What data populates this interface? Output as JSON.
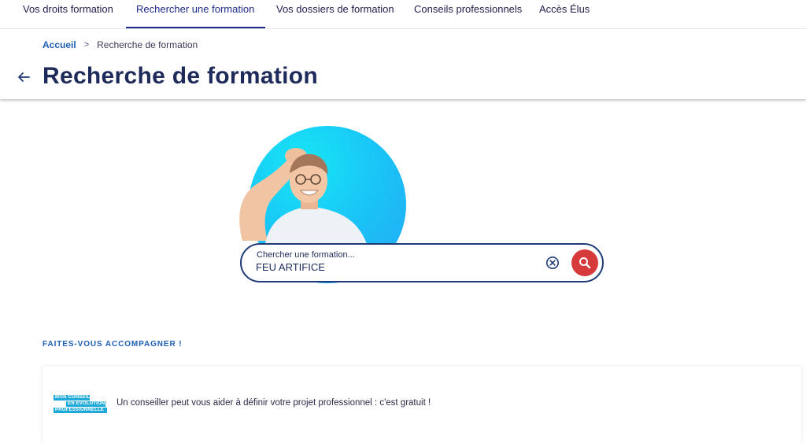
{
  "nav": {
    "items": [
      {
        "label": "Vos droits formation"
      },
      {
        "label": "Rechercher une formation",
        "active": true
      },
      {
        "label": "Vos dossiers de formation"
      },
      {
        "label": "Conseils professionnels"
      },
      {
        "label": "Accès Élus"
      }
    ]
  },
  "breadcrumb": {
    "home": "Accueil",
    "separator": ">",
    "current": "Recherche de formation"
  },
  "page": {
    "title": "Recherche de formation"
  },
  "search": {
    "label": "Chercher une formation...",
    "value": "FEU ARTIFICE"
  },
  "accompaniment": {
    "heading": "FAITES-VOUS ACCOMPAGNER !",
    "logo_lines": [
      "MON CONSEIL",
      "EN ÉVOLUTION",
      "PROFESSIONNELLE"
    ],
    "text": "Un conseiller peut vous aider à définir votre projet professionnel : c'est gratuit !"
  },
  "colors": {
    "nav_active": "#1e2a8a",
    "search_button": "#d63a3a",
    "hero_circle": "#19c6f6",
    "link": "#1e5fb4"
  }
}
